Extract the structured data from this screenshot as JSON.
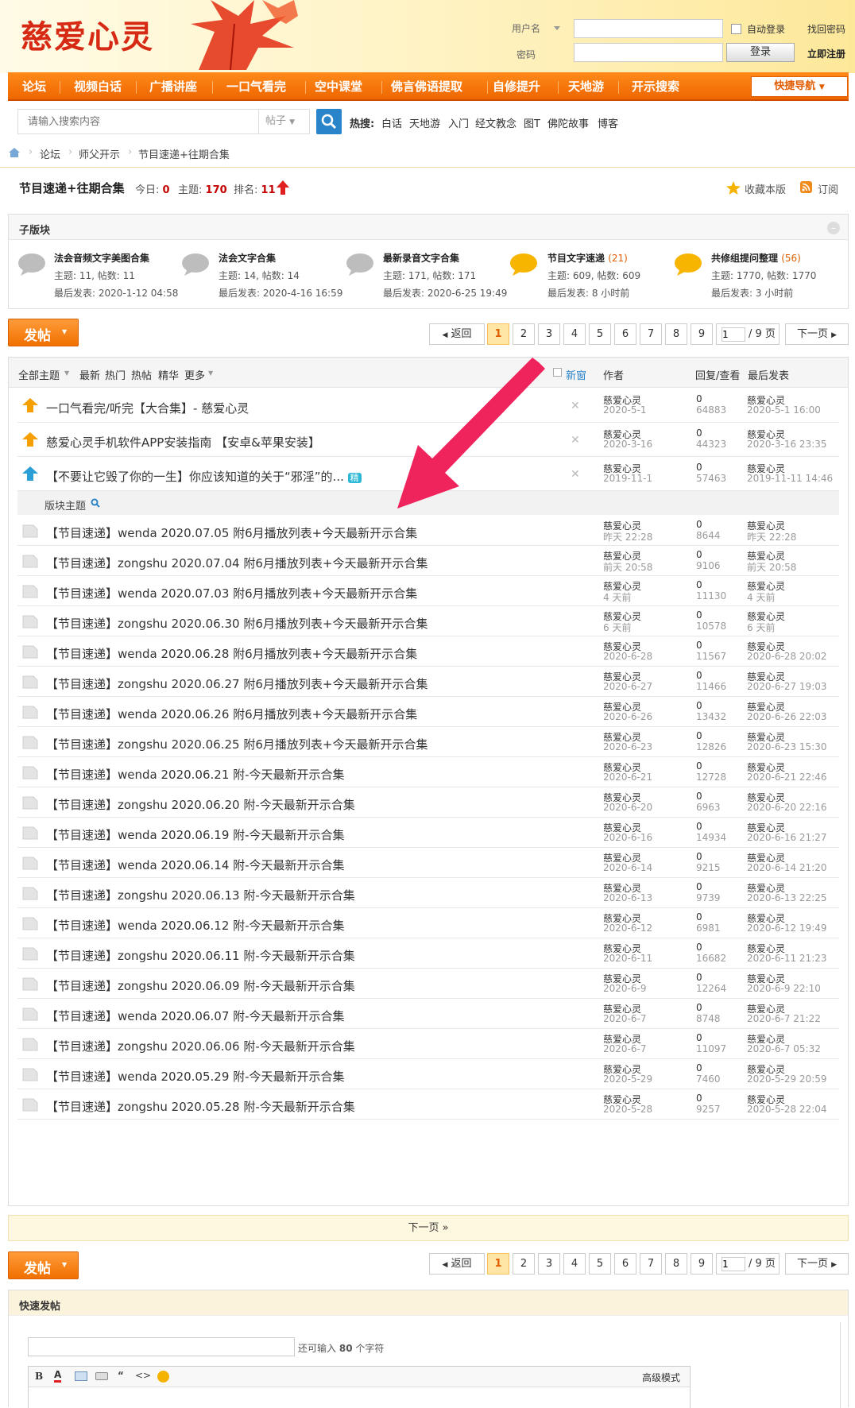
{
  "header": {
    "logo": "慈爱心灵",
    "username_label": "用户名",
    "password_label": "密码",
    "autologin": "自动登录",
    "forgot": "找回密码",
    "login": "登录",
    "register": "立即注册"
  },
  "nav": {
    "items": [
      "论坛",
      "视频白话",
      "广播讲座",
      "一口气看完",
      "空中课堂",
      "佛言佛语提取",
      "自修提升",
      "天地游",
      "开示搜索"
    ],
    "quick": "快捷导航"
  },
  "search": {
    "placeholder": "请输入搜索内容",
    "type": "帖子",
    "hot_label": "热搜:",
    "hot": [
      "白话",
      "天地游",
      "入门",
      "经文教念",
      "图T",
      "佛陀故事",
      "博客"
    ]
  },
  "breadcrumb": [
    "论坛",
    "师父开示",
    "节目速递+往期合集"
  ],
  "forum": {
    "title": "节目速递+往期合集",
    "today_label": "今日:",
    "today": "0",
    "threads_label": "主题:",
    "threads": "170",
    "rank_label": "排名:",
    "rank": "11",
    "favorite": "收藏本版",
    "subscribe": "订阅"
  },
  "subforums": {
    "heading": "子版块",
    "items": [
      {
        "name": "法会音频文字美图合集",
        "count": "",
        "stats": "主题: 11, 帖数: 11",
        "last": "最后发表: 2020-1-12 04:58",
        "active": false
      },
      {
        "name": "法会文字合集",
        "count": "",
        "stats": "主题: 14, 帖数: 14",
        "last": "最后发表: 2020-4-16 16:59",
        "active": false
      },
      {
        "name": "最新录音文字合集",
        "count": "",
        "stats": "主题: 171, 帖数: 171",
        "last": "最后发表: 2020-6-25 19:49",
        "active": false
      },
      {
        "name": "节目文字速递",
        "count": "(21)",
        "stats": "主题: 609, 帖数: 609",
        "last": "最后发表: 8 小时前",
        "active": true
      },
      {
        "name": "共修组提问整理",
        "count": "(56)",
        "stats": "主题: 1770, 帖数: 1770",
        "last": "最后发表: 3 小时前",
        "active": true
      }
    ]
  },
  "pager": {
    "post_label": "发帖",
    "back": "返回",
    "pages": [
      "1",
      "2",
      "3",
      "4",
      "5",
      "6",
      "7",
      "8",
      "9"
    ],
    "current": "1",
    "page_input": "1",
    "total": "/ 9 页",
    "next": "下一页"
  },
  "table": {
    "filters": [
      "全部主题",
      "最新",
      "热门",
      "热帖",
      "精华",
      "更多"
    ],
    "new_window": "新窗",
    "col_author": "作者",
    "col_reply": "回复/查看",
    "col_last": "最后发表",
    "section_label": "版块主题",
    "sticky": [
      {
        "title": "一口气看完/听完【大合集】- 慈爱心灵",
        "author": "慈爱心灵",
        "date": "2020-5-1",
        "replies": "0",
        "views": "64883",
        "last_author": "慈爱心灵",
        "last_date": "2020-5-1 16:00",
        "tag": ""
      },
      {
        "title": "慈爱心灵手机软件APP安装指南 【安卓&苹果安装】",
        "author": "慈爱心灵",
        "date": "2020-3-16",
        "replies": "0",
        "views": "44323",
        "last_author": "慈爱心灵",
        "last_date": "2020-3-16 23:35",
        "tag": ""
      },
      {
        "title": "【不要让它毁了你的一生】你应该知道的关于“邪淫”的...",
        "author": "慈爱心灵",
        "date": "2019-11-1",
        "replies": "0",
        "views": "57463",
        "last_author": "慈爱心灵",
        "last_date": "2019-11-11 14:46",
        "tag": "精"
      }
    ],
    "rows": [
      {
        "title": "【节目速递】wenda 2020.07.05 附6月播放列表+今天最新开示合集",
        "date": "昨天 22:28",
        "views": "8644",
        "last_date": "昨天 22:28"
      },
      {
        "title": "【节目速递】zongshu 2020.07.04 附6月播放列表+今天最新开示合集",
        "date": "前天 20:58",
        "views": "9106",
        "last_date": "前天 20:58"
      },
      {
        "title": "【节目速递】wenda 2020.07.03 附6月播放列表+今天最新开示合集",
        "date": "4 天前",
        "views": "11130",
        "last_date": "4 天前"
      },
      {
        "title": "【节目速递】zongshu 2020.06.30 附6月播放列表+今天最新开示合集",
        "date": "6 天前",
        "views": "10578",
        "last_date": "6 天前"
      },
      {
        "title": "【节目速递】wenda 2020.06.28 附6月播放列表+今天最新开示合集",
        "date": "2020-6-28",
        "views": "11567",
        "last_date": "2020-6-28 20:02"
      },
      {
        "title": "【节目速递】zongshu 2020.06.27 附6月播放列表+今天最新开示合集",
        "date": "2020-6-27",
        "views": "11466",
        "last_date": "2020-6-27 19:03"
      },
      {
        "title": "【节目速递】wenda 2020.06.26 附6月播放列表+今天最新开示合集",
        "date": "2020-6-26",
        "views": "13432",
        "last_date": "2020-6-26 22:03"
      },
      {
        "title": "【节目速递】zongshu 2020.06.25 附6月播放列表+今天最新开示合集",
        "date": "2020-6-23",
        "views": "12826",
        "last_date": "2020-6-23 15:30"
      },
      {
        "title": "【节目速递】wenda 2020.06.21 附-今天最新开示合集",
        "date": "2020-6-21",
        "views": "12728",
        "last_date": "2020-6-21 22:46"
      },
      {
        "title": "【节目速递】zongshu 2020.06.20 附-今天最新开示合集",
        "date": "2020-6-20",
        "views": "6963",
        "last_date": "2020-6-20 22:16"
      },
      {
        "title": "【节目速递】wenda 2020.06.19 附-今天最新开示合集",
        "date": "2020-6-16",
        "views": "14934",
        "last_date": "2020-6-16 21:27"
      },
      {
        "title": "【节目速递】wenda 2020.06.14 附-今天最新开示合集",
        "date": "2020-6-14",
        "views": "9215",
        "last_date": "2020-6-14 21:20"
      },
      {
        "title": "【节目速递】zongshu 2020.06.13 附-今天最新开示合集",
        "date": "2020-6-13",
        "views": "9739",
        "last_date": "2020-6-13 22:25"
      },
      {
        "title": "【节目速递】wenda 2020.06.12 附-今天最新开示合集",
        "date": "2020-6-12",
        "views": "6981",
        "last_date": "2020-6-12 19:49"
      },
      {
        "title": "【节目速递】zongshu 2020.06.11 附-今天最新开示合集",
        "date": "2020-6-11",
        "views": "16682",
        "last_date": "2020-6-11 21:23"
      },
      {
        "title": "【节目速递】zongshu 2020.06.09 附-今天最新开示合集",
        "date": "2020-6-9",
        "views": "12264",
        "last_date": "2020-6-9 22:10"
      },
      {
        "title": "【节目速递】wenda 2020.06.07 附-今天最新开示合集",
        "date": "2020-6-7",
        "views": "8748",
        "last_date": "2020-6-7 21:22"
      },
      {
        "title": "【节目速递】zongshu 2020.06.06 附-今天最新开示合集",
        "date": "2020-6-7",
        "views": "11097",
        "last_date": "2020-6-7 05:32"
      },
      {
        "title": "【节目速递】wenda 2020.05.29 附-今天最新开示合集",
        "date": "2020-5-29",
        "views": "7460",
        "last_date": "2020-5-29 20:59"
      },
      {
        "title": "【节目速递】zongshu 2020.05.28 附-今天最新开示合集",
        "date": "2020-5-28",
        "views": "9257",
        "last_date": "2020-5-28 22:04"
      }
    ],
    "row_author": "慈爱心灵",
    "row_replies": "0"
  },
  "next_page": "下一页 »",
  "fastpost": {
    "heading": "快速发帖",
    "remain_prefix": "还可输入",
    "remain": "80",
    "remain_suffix": "个字符",
    "advanced": "高级模式"
  },
  "colors": {
    "accent": "#ff7a00",
    "link": "#2a84c9",
    "red": "#c40000",
    "annotation": "#f0245d"
  }
}
